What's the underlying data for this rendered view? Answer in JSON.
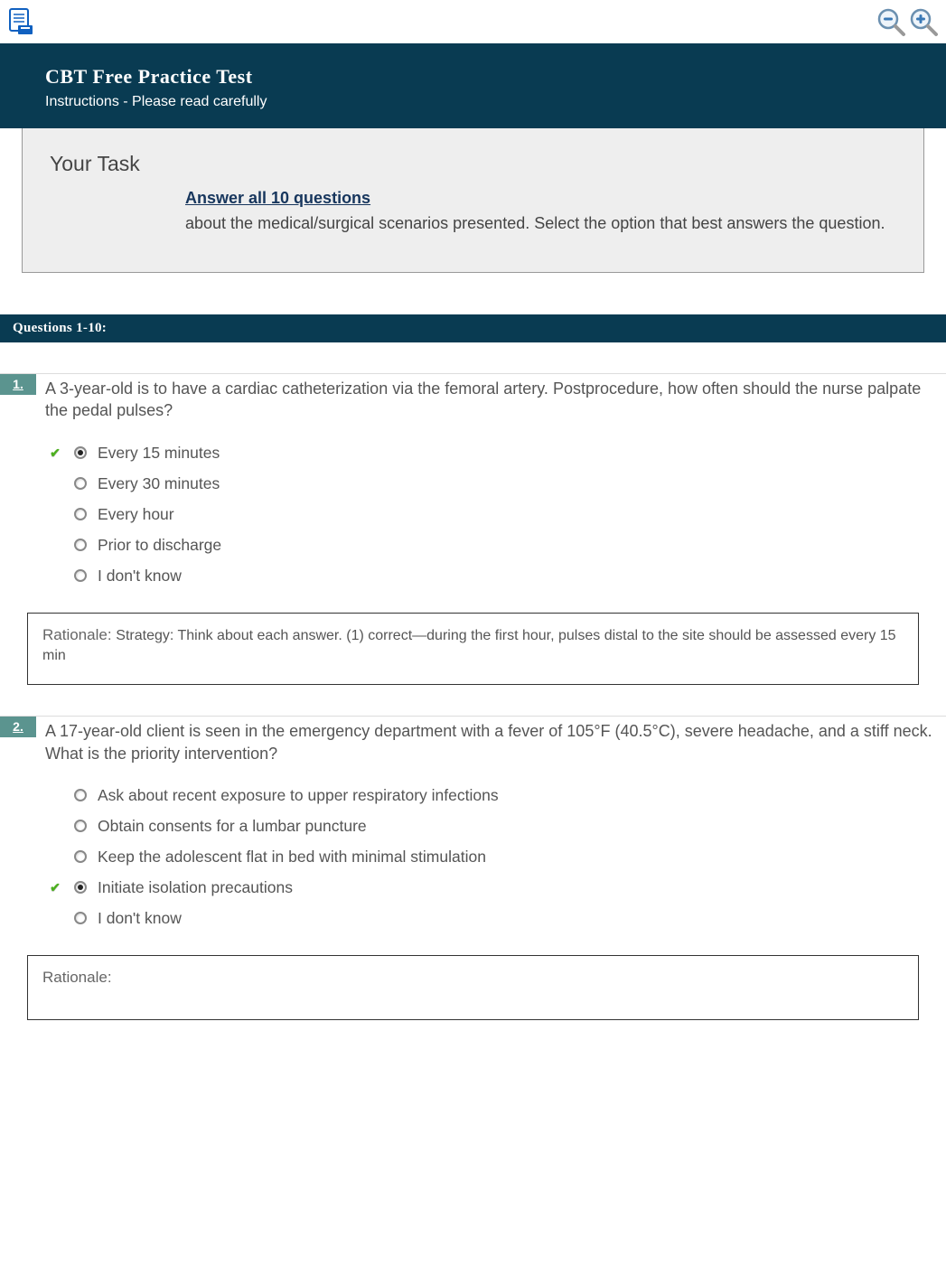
{
  "banner": {
    "title": "CBT Free Practice Test",
    "subtitle": "Instructions - Please read carefully"
  },
  "task": {
    "label": "Your Task",
    "link_text": "Answer all 10 questions",
    "rest_text": "about the medical/surgical scenarios presented. Select the option that best answers the question."
  },
  "section": {
    "heading": "Questions 1-10:"
  },
  "questions": [
    {
      "num": "1.",
      "text": "A 3-year-old is to have a cardiac catheterization via the femoral artery. Postprocedure, how often should the nurse palpate the pedal pulses?",
      "options": [
        {
          "label": "Every 15 minutes",
          "selected": true,
          "correct": true
        },
        {
          "label": "Every 30 minutes",
          "selected": false,
          "correct": false
        },
        {
          "label": "Every hour",
          "selected": false,
          "correct": false
        },
        {
          "label": "Prior to discharge",
          "selected": false,
          "correct": false
        },
        {
          "label": "I don't know",
          "selected": false,
          "correct": false
        }
      ],
      "rationale_label": "Rationale:",
      "rationale_text": "Strategy: Think about each answer. (1) correct—during the first hour, pulses distal to the site should be assessed every 15 min"
    },
    {
      "num": "2.",
      "text": "A 17-year-old client is seen in the emergency department with a fever of 105°F (40.5°C), severe headache, and a stiff neck. What is the priority intervention?",
      "options": [
        {
          "label": "Ask about recent exposure to upper respiratory infections",
          "selected": false,
          "correct": false
        },
        {
          "label": "Obtain consents for a lumbar puncture",
          "selected": false,
          "correct": false
        },
        {
          "label": "Keep the adolescent flat in bed with minimal stimulation",
          "selected": false,
          "correct": false
        },
        {
          "label": "Initiate isolation precautions",
          "selected": true,
          "correct": true
        },
        {
          "label": "I don't know",
          "selected": false,
          "correct": false
        }
      ],
      "rationale_label": "Rationale:",
      "rationale_text": ""
    }
  ]
}
